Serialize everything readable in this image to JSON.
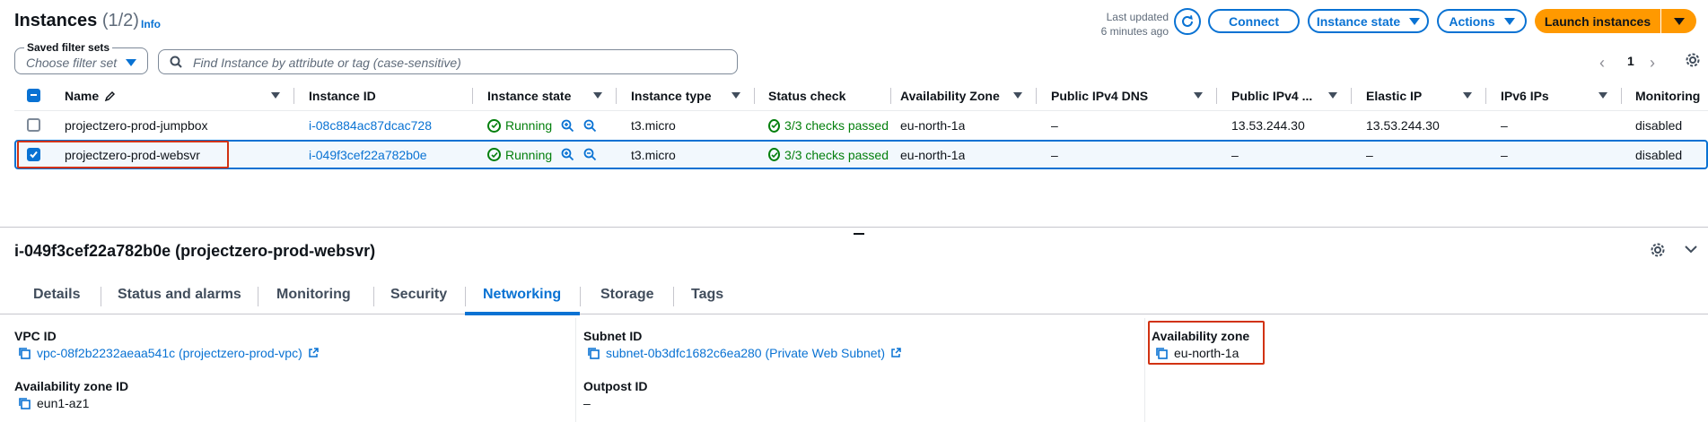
{
  "header": {
    "title": "Instances",
    "count": "(1/2)",
    "info": "Info",
    "last_updated_line1": "Last updated",
    "last_updated_line2": "6 minutes ago",
    "connect": "Connect",
    "instance_state": "Instance state",
    "actions": "Actions",
    "launch": "Launch instances"
  },
  "filter": {
    "saved_label": "Saved filter sets",
    "saved_placeholder": "Choose filter set",
    "search_placeholder": "Find Instance by attribute or tag (case-sensitive)"
  },
  "pagination": {
    "page": "1"
  },
  "columns": {
    "name": "Name",
    "id": "Instance ID",
    "state": "Instance state",
    "type": "Instance type",
    "status": "Status check",
    "az": "Availability Zone",
    "dns": "Public IPv4 DNS",
    "ipv4": "Public IPv4 ...",
    "eip": "Elastic IP",
    "ipv6": "IPv6 IPs",
    "monitoring": "Monitoring"
  },
  "rows": [
    {
      "name": "projectzero-prod-jumpbox",
      "id": "i-08c884ac87dcac728",
      "state": "Running",
      "type": "t3.micro",
      "status": "3/3 checks passed",
      "az": "eu-north-1a",
      "dns": "–",
      "ipv4": "13.53.244.30",
      "eip": "13.53.244.30",
      "ipv6": "–",
      "monitoring": "disabled"
    },
    {
      "name": "projectzero-prod-websvr",
      "id": "i-049f3cef22a782b0e",
      "state": "Running",
      "type": "t3.micro",
      "status": "3/3 checks passed",
      "az": "eu-north-1a",
      "dns": "–",
      "ipv4": "–",
      "eip": "–",
      "ipv6": "–",
      "monitoring": "disabled"
    }
  ],
  "detail": {
    "title": "i-049f3cef22a782b0e (projectzero-prod-websvr)",
    "tabs": [
      "Details",
      "Status and alarms",
      "Monitoring",
      "Security",
      "Networking",
      "Storage",
      "Tags"
    ],
    "active_tab": "Networking",
    "vpc_label": "VPC ID",
    "vpc_value": "vpc-08f2b2232aeaa541c (projectzero-prod-vpc)",
    "subnet_label": "Subnet ID",
    "subnet_value": "subnet-0b3dfc1682c6ea280 (Private Web Subnet)",
    "az_label": "Availability zone",
    "az_value": "eu-north-1a",
    "azid_label": "Availability zone ID",
    "azid_value": "eun1-az1",
    "outpost_label": "Outpost ID",
    "outpost_value": "–"
  },
  "colors": {
    "accent": "#0972d3",
    "launch": "#ff9900",
    "success": "#037f0c",
    "highlight": "#d13212"
  }
}
